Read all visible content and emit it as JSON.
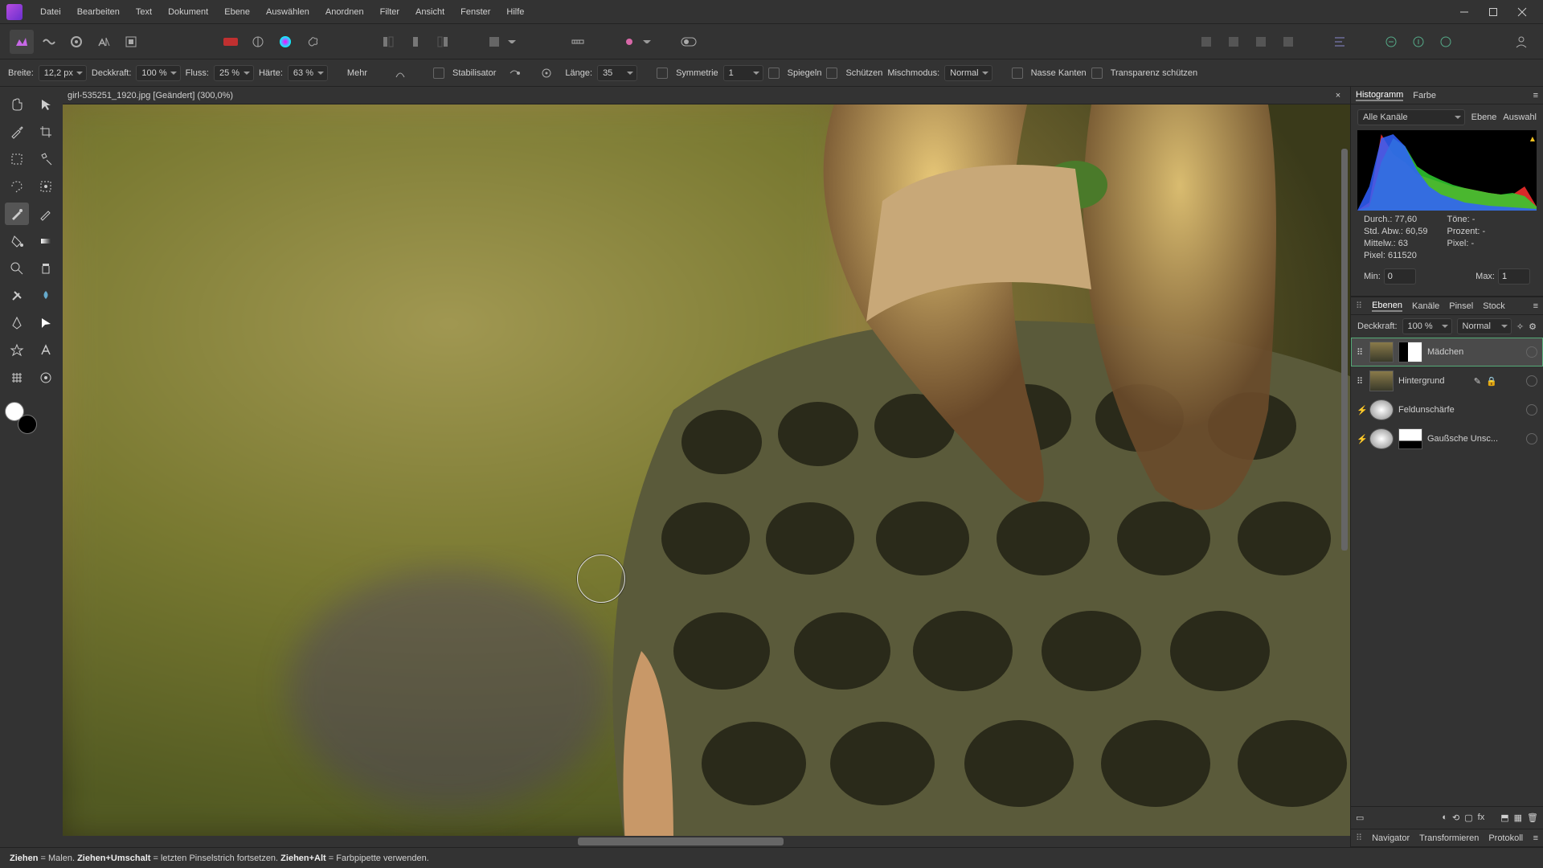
{
  "menu": {
    "items": [
      "Datei",
      "Bearbeiten",
      "Text",
      "Dokument",
      "Ebene",
      "Auswählen",
      "Anordnen",
      "Filter",
      "Ansicht",
      "Fenster",
      "Hilfe"
    ]
  },
  "context": {
    "width_label": "Breite:",
    "width": "12,2 px",
    "opacity_label": "Deckkraft:",
    "opacity": "100 %",
    "flow_label": "Fluss:",
    "flow": "25 %",
    "hardness_label": "Härte:",
    "hardness": "63 %",
    "more": "Mehr",
    "stabilizer": "Stabilisator",
    "length_label": "Länge:",
    "length": "35",
    "symmetry": "Symmetrie",
    "symmetry_val": "1",
    "mirror": "Spiegeln",
    "protect": "Schützen",
    "blend_label": "Mischmodus:",
    "blend": "Normal",
    "wet": "Nasse Kanten",
    "transp": "Transparenz schützen"
  },
  "doc": {
    "title": "girl-535251_1920.jpg [Geändert] (300,0%)"
  },
  "hist_tabs": {
    "hist": "Histogramm",
    "color": "Farbe"
  },
  "hist": {
    "channels": "Alle Kanäle",
    "layer": "Ebene",
    "sel": "Auswahl",
    "mean_l": "Durch.:",
    "mean": "77,60",
    "std_l": "Std. Abw.:",
    "std": "60,59",
    "median_l": "Mittelw.:",
    "median": "63",
    "pixels_l": "Pixel:",
    "pixels": "611520",
    "tones_l": "Töne:",
    "tones": "-",
    "pct_l": "Prozent:",
    "pct": "-",
    "pixel2_l": "Pixel:",
    "pixel2": "-",
    "min_l": "Min:",
    "min": "0",
    "max_l": "Max:",
    "max": "1"
  },
  "layertabs": {
    "layers": "Ebenen",
    "channels": "Kanäle",
    "brushes": "Pinsel",
    "stock": "Stock"
  },
  "layeropts": {
    "opacity_l": "Deckkraft:",
    "opacity": "100 %",
    "blend": "Normal"
  },
  "layers": [
    {
      "name": "Mädchen"
    },
    {
      "name": "Hintergrund"
    },
    {
      "name": "Feldunschärfe"
    },
    {
      "name": "Gaußsche Unsc..."
    }
  ],
  "btabs": {
    "nav": "Navigator",
    "transform": "Transformieren",
    "history": "Protokoll"
  },
  "status": {
    "s1": "Ziehen",
    "e1": " = Malen. ",
    "s2": "Ziehen+Umschalt",
    "e2": " = letzten Pinselstrich fortsetzen. ",
    "s3": "Ziehen+Alt",
    "e3": " = Farbpipette verwenden."
  },
  "chart_data": {
    "type": "area",
    "title": "Histogramm",
    "xlabel": "",
    "ylabel": "",
    "xlim": [
      0,
      255
    ],
    "ylim": [
      0,
      1
    ],
    "series": [
      {
        "name": "R",
        "color": "#ff3030",
        "values": [
          0.0,
          0.1,
          0.95,
          0.7,
          0.6,
          0.45,
          0.4,
          0.35,
          0.3,
          0.28,
          0.25,
          0.22,
          0.2,
          0.2,
          0.3,
          0.05
        ]
      },
      {
        "name": "G",
        "color": "#30d030",
        "values": [
          0.0,
          0.05,
          0.6,
          0.9,
          0.8,
          0.55,
          0.45,
          0.38,
          0.32,
          0.28,
          0.25,
          0.22,
          0.2,
          0.22,
          0.18,
          0.05
        ]
      },
      {
        "name": "B",
        "color": "#3060ff",
        "values": [
          0.0,
          0.3,
          0.9,
          0.95,
          0.8,
          0.5,
          0.3,
          0.2,
          0.15,
          0.1,
          0.08,
          0.06,
          0.05,
          0.04,
          0.03,
          0.02
        ]
      }
    ]
  }
}
